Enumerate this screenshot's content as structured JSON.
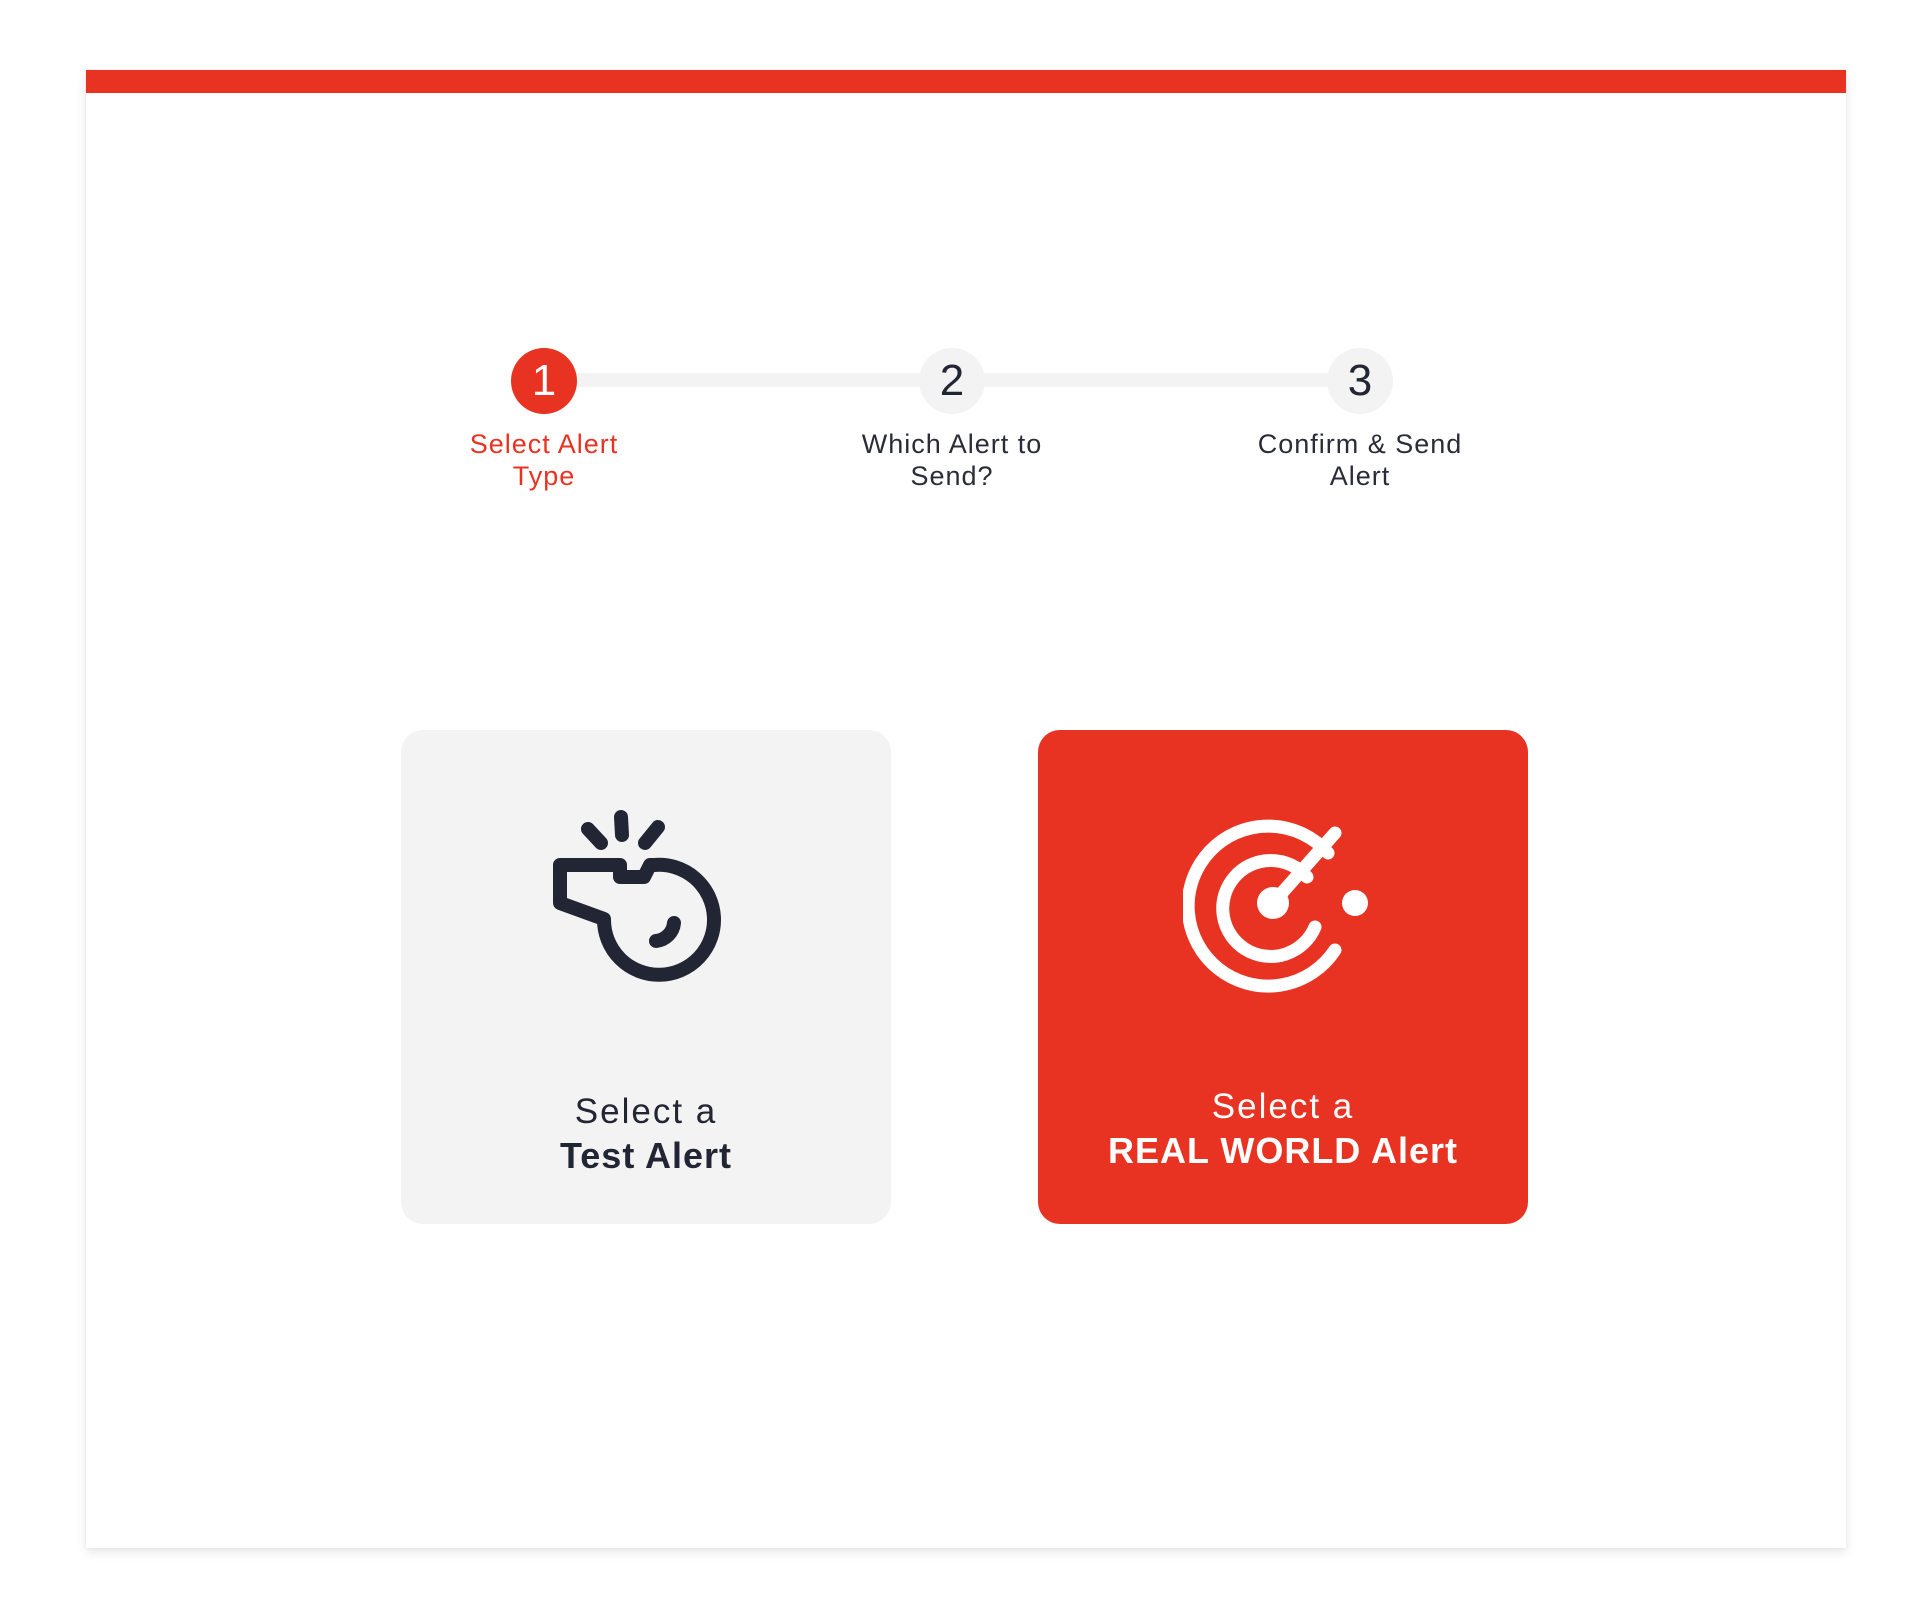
{
  "colors": {
    "accent": "#e83323",
    "inactive_step": "#f3f3f3",
    "text_dark": "#222533",
    "card_light": "#f3f3f3"
  },
  "stepper": {
    "steps": [
      {
        "number": "1",
        "label_line1": "Select Alert",
        "label_line2": "Type",
        "state": "active"
      },
      {
        "number": "2",
        "label_line1": "Which Alert to",
        "label_line2": "Send?",
        "state": "inactive"
      },
      {
        "number": "3",
        "label_line1": "Confirm & Send",
        "label_line2": "Alert",
        "state": "inactive"
      }
    ]
  },
  "options": {
    "test": {
      "line1": "Select a",
      "line2": "Test Alert",
      "icon": "whistle-icon"
    },
    "real": {
      "line1": "Select a",
      "line2": "REAL WORLD Alert",
      "icon": "radar-target-icon"
    }
  }
}
